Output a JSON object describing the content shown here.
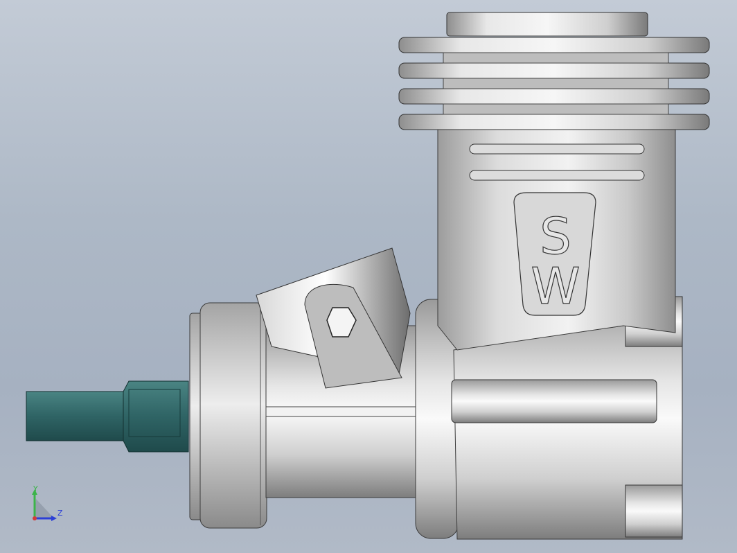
{
  "viewport": {
    "background_top": "#c3cbd6",
    "background_bottom": "#a6b1c1"
  },
  "model": {
    "logo_letters": [
      "S",
      "W"
    ],
    "shaft_color": "#2f6465",
    "body_color": "#c8c8c8"
  },
  "triad": {
    "y_label": "Y",
    "z_label": "Z",
    "y_color": "#3cb44a",
    "z_color": "#2c3fd6",
    "x_color": "#d23a3a"
  }
}
